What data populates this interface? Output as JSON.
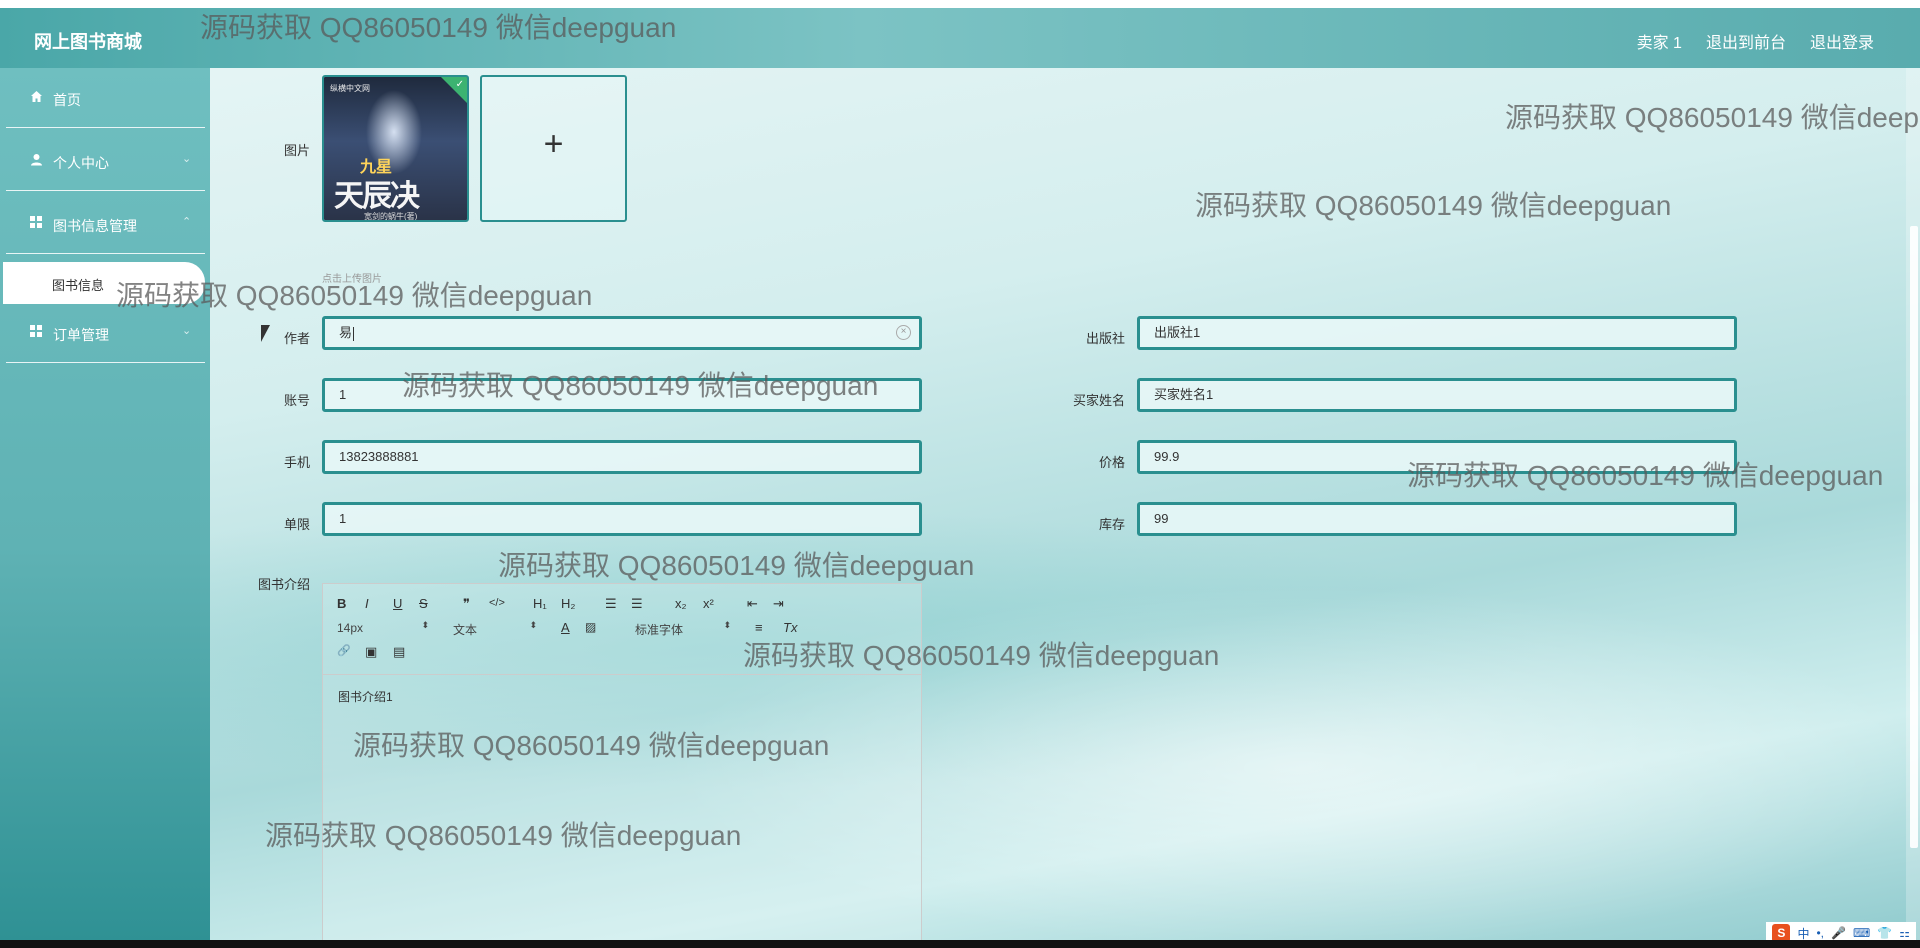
{
  "header": {
    "brand": "网上图书商城",
    "links": [
      "卖家 1",
      "退出到前台",
      "退出登录"
    ]
  },
  "sidebar": {
    "items": [
      {
        "label": "首页",
        "icon": "home-icon"
      },
      {
        "label": "个人中心",
        "icon": "user-icon"
      },
      {
        "label": "图书信息管理",
        "icon": "grid-icon"
      },
      {
        "label": "订单管理",
        "icon": "grid-icon"
      }
    ],
    "sub_item": "图书信息"
  },
  "form": {
    "image_label": "图片",
    "upload_plus": "+",
    "upload_hint": "点击上传图片",
    "cover": {
      "series": "九星",
      "title": "天辰决",
      "publisher": "纵横中文网",
      "author_line": "宽剑的蜗牛(著)"
    },
    "fields": {
      "author": {
        "label": "作者",
        "value": "易"
      },
      "publisher": {
        "label": "出版社",
        "value": "出版社1"
      },
      "account": {
        "label": "账号",
        "value": "1"
      },
      "buyer_name": {
        "label": "买家姓名",
        "value": "买家姓名1"
      },
      "phone": {
        "label": "手机",
        "value": "13823888881"
      },
      "price": {
        "label": "价格",
        "value": "99.9"
      },
      "limit": {
        "label": "单限",
        "value": "1"
      },
      "stock": {
        "label": "库存",
        "value": "99"
      }
    },
    "intro_label": "图书介绍",
    "editor": {
      "buttons": {
        "bold": "B",
        "italic": "I",
        "underline": "U",
        "strike": "S",
        "quote": "❞",
        "code": "</>",
        "h1": "H₁",
        "h2": "H₂",
        "ol": "☰",
        "ul": "☰",
        "sub": "x₂",
        "sup": "x²",
        "outdent": "⇤",
        "indent": "⇥",
        "color": "A",
        "bg": "▨",
        "align": "≡",
        "clear": "Tx",
        "link": "🔗",
        "image": "▣",
        "video": "▤"
      },
      "size_select": "14px",
      "text_select": "文本",
      "font_select": "标准字体",
      "content": "图书介绍1"
    }
  },
  "watermark_text": "源码获取 QQ86050149 微信deepguan",
  "ime": {
    "logo": "S",
    "items": [
      "中",
      "•,",
      "🎤",
      "⌨",
      "👕",
      "⚏"
    ]
  },
  "colors": {
    "accent": "#2a8f8f",
    "header": "#5fb3b4",
    "sidebar": "#5fb2b4"
  }
}
